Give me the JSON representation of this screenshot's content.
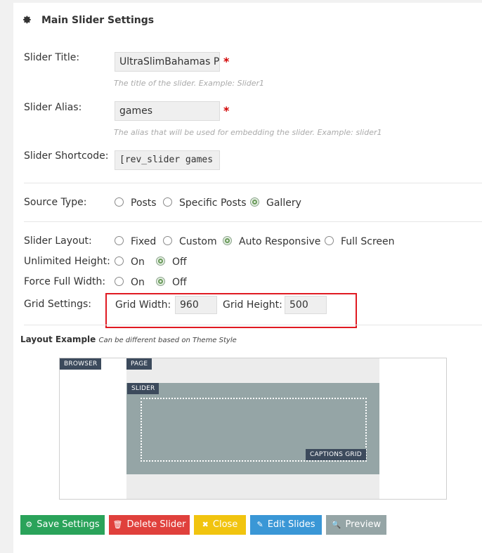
{
  "header": {
    "title": "Main Slider Settings",
    "icon": "gear-icon"
  },
  "fields": {
    "slider_title": {
      "label": "Slider Title:",
      "value": "UltraSlimBahamas Pr",
      "required": "*",
      "help": "The title of the slider. Example: Slider1"
    },
    "slider_alias": {
      "label": "Slider Alias:",
      "value": "games",
      "required": "*",
      "help": "The alias that will be used for embedding the slider. Example: slider1"
    },
    "slider_shortcode": {
      "label": "Slider Shortcode:",
      "value": "[rev_slider games"
    }
  },
  "source_type": {
    "label": "Source Type:",
    "options": [
      "Posts",
      "Specific Posts",
      "Gallery"
    ],
    "selected": "Gallery"
  },
  "slider_layout": {
    "label": "Slider Layout:",
    "options": [
      "Fixed",
      "Custom",
      "Auto Responsive",
      "Full Screen"
    ],
    "selected": "Auto Responsive"
  },
  "unlimited_height": {
    "label": "Unlimited Height:",
    "options": [
      "On",
      "Off"
    ],
    "selected": "Off"
  },
  "force_full_width": {
    "label": "Force Full Width:",
    "options": [
      "On",
      "Off"
    ],
    "selected": "Off"
  },
  "grid_settings": {
    "label": "Grid Settings:",
    "width_label": "Grid Width:",
    "width_value": "960",
    "height_label": "Grid Height:",
    "height_value": "500"
  },
  "layout_example": {
    "title": "Layout Example",
    "subtitle": "Can be different based on Theme Style",
    "tags": {
      "browser": "BROWSER",
      "page": "PAGE",
      "slider": "SLIDER",
      "captions": "CAPTIONS GRID"
    }
  },
  "buttons": {
    "save": "Save Settings",
    "delete": "Delete Slider",
    "close": "Close",
    "edit": "Edit Slides",
    "preview": "Preview"
  },
  "colors": {
    "save": "#2aa35a",
    "delete": "#e0403c",
    "close": "#f1c40f",
    "edit": "#3a97d6",
    "preview": "#95a5a6",
    "highlight": "#e01a22",
    "radio_checked": "#6a9a5a"
  }
}
